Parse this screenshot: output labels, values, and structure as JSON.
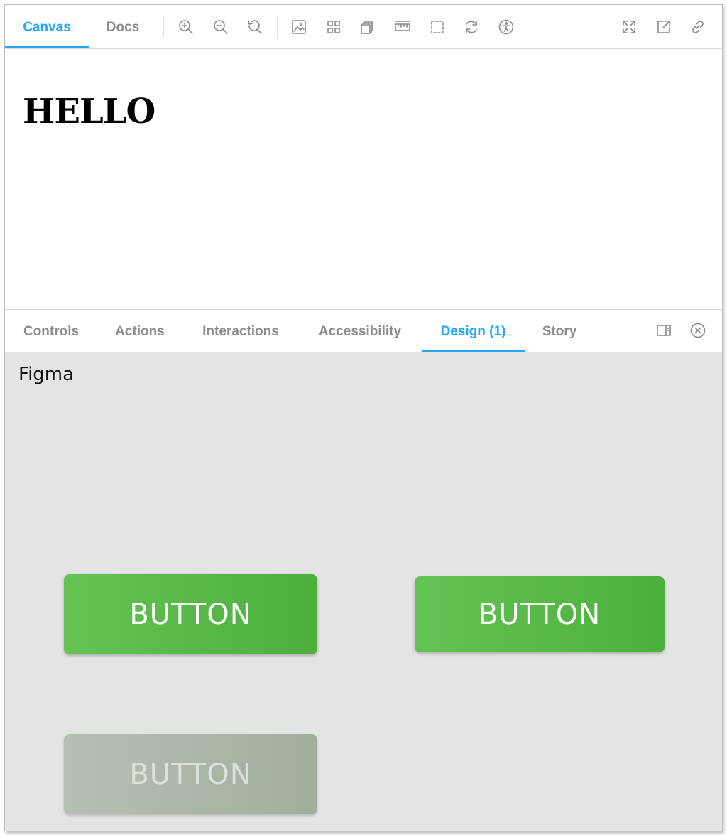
{
  "toolbar": {
    "tabs": [
      {
        "label": "Canvas",
        "active": true
      },
      {
        "label": "Docs",
        "active": false
      }
    ],
    "icons": [
      "zoom-in-icon",
      "zoom-out-icon",
      "zoom-reset-icon",
      "background-icon",
      "grid-icon",
      "measure-icon",
      "ruler-icon",
      "outline-icon",
      "remount-icon",
      "accessibility-icon",
      "fullscreen-icon",
      "open-new-tab-icon",
      "copy-link-icon"
    ]
  },
  "preview": {
    "heading": "HELLO"
  },
  "panel": {
    "tabs": [
      {
        "label": "Controls",
        "active": false
      },
      {
        "label": "Actions",
        "active": false
      },
      {
        "label": "Interactions",
        "active": false
      },
      {
        "label": "Accessibility",
        "active": false
      },
      {
        "label": "Design (1)",
        "active": true
      },
      {
        "label": "Story",
        "active": false
      }
    ],
    "icons": [
      "panel-orientation-icon",
      "close-panel-icon"
    ]
  },
  "design": {
    "source_label": "Figma",
    "buttons": [
      {
        "label": "BUTTON",
        "state": "default"
      },
      {
        "label": "BUTTON",
        "state": "default"
      },
      {
        "label": "BUTTON",
        "state": "disabled"
      }
    ]
  },
  "colors": {
    "accent": "#1ea7fd",
    "button_green": "#56b845",
    "button_disabled": "#aab5a6",
    "panel_background": "#e4e4e4"
  }
}
